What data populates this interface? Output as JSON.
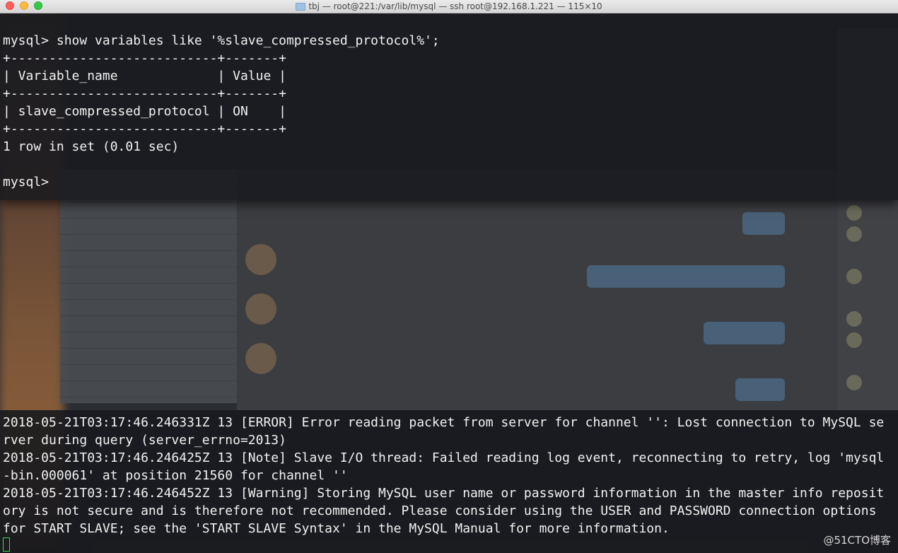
{
  "window": {
    "title": "tbj — root@221:/var/lib/mysql — ssh root@192.168.1.221 — 115×10"
  },
  "terminal": {
    "lines": [
      "mysql> show variables like '%slave_compressed_protocol%';",
      "+---------------------------+-------+",
      "| Variable_name             | Value |",
      "+---------------------------+-------+",
      "| slave_compressed_protocol | ON    |",
      "+---------------------------+-------+",
      "1 row in set (0.01 sec)",
      "",
      "mysql>"
    ]
  },
  "log": {
    "lines": [
      "2018-05-21T03:17:46.246331Z 13 [ERROR] Error reading packet from server for channel '': Lost connection to MySQL se",
      "rver during query (server_errno=2013)",
      "2018-05-21T03:17:46.246425Z 13 [Note] Slave I/O thread: Failed reading log event, reconnecting to retry, log 'mysql",
      "-bin.000061' at position 21560 for channel ''",
      "2018-05-21T03:17:46.246452Z 13 [Warning] Storing MySQL user name or password information in the master info reposit",
      "ory is not secure and is therefore not recommended. Please consider using the USER and PASSWORD connection options",
      "for START SLAVE; see the 'START SLAVE Syntax' in the MySQL Manual for more information."
    ]
  },
  "watermark": "@51CTO博客",
  "colors": {
    "terminal_text": "#f2f2f2",
    "cursor": "#3bd44a",
    "close": "#fc605c",
    "minimize": "#fdbc40",
    "maximize": "#34c84a"
  }
}
